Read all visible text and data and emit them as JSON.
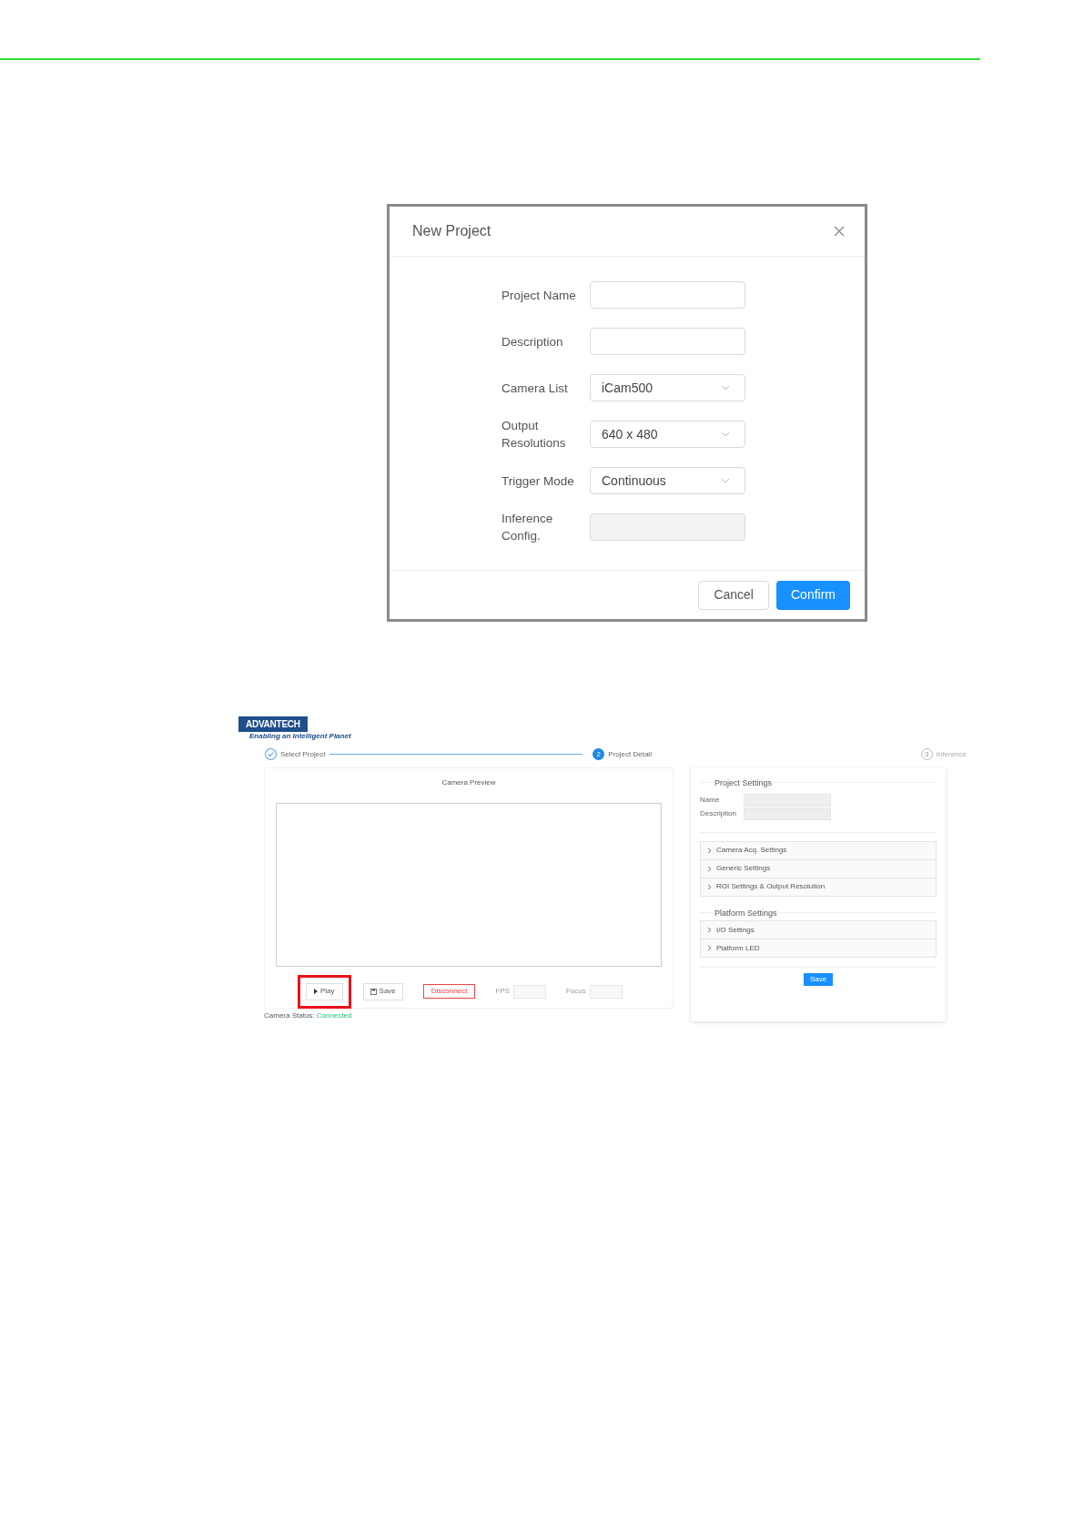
{
  "dialog": {
    "title": "New Project",
    "fields": [
      {
        "label": "Project Name",
        "kind": "text"
      },
      {
        "label": "Description",
        "kind": "text"
      },
      {
        "label": "Camera List",
        "kind": "select",
        "value": "iCam500"
      },
      {
        "label": "Output Resolutions",
        "kind": "select",
        "value": "640 x 480"
      },
      {
        "label": "Trigger Mode",
        "kind": "select",
        "value": "Continuous"
      },
      {
        "label": "Inference Config.",
        "kind": "disabled"
      }
    ],
    "buttons": [
      {
        "label": "Cancel",
        "kind": "secondary"
      },
      {
        "label": "Confirm",
        "kind": "primary"
      }
    ]
  },
  "app": {
    "logo": {
      "name": "ADVANTECH",
      "tagline": "Enabling an Intelligent Planet"
    },
    "steps": [
      {
        "label": "Select Project",
        "kind": "done"
      },
      {
        "label": "Project Detail",
        "kind": "current",
        "number": "2"
      },
      {
        "label": "Inference",
        "kind": "upcoming",
        "number": "3"
      }
    ],
    "preview": {
      "title": "Camera Preview",
      "controls": [
        {
          "label": "Play",
          "kind": "play",
          "highlighted": true
        },
        {
          "label": "Save",
          "kind": "save"
        },
        {
          "label": "Disconnect",
          "kind": "danger"
        },
        {
          "label": "FPS",
          "kind": "field"
        },
        {
          "label": "Focus",
          "kind": "field"
        }
      ],
      "status_label": "Camera Status:",
      "status_value": "Connected"
    },
    "settings": {
      "project_title": "Project Settings",
      "project_fields": [
        {
          "label": "Name"
        },
        {
          "label": "Description"
        }
      ],
      "camera_sections": [
        {
          "label": "Camera Acq. Settings",
          "expanded": false
        },
        {
          "label": "Generic Settings",
          "expanded": false
        },
        {
          "label": "ROI Settings & Output Resolution",
          "expanded": false
        }
      ],
      "platform_title": "Platform Settings",
      "platform_sections": [
        {
          "label": "I/O Settings",
          "expanded": false
        },
        {
          "label": "Platform LED",
          "expanded": false
        }
      ],
      "save": "Save"
    }
  }
}
